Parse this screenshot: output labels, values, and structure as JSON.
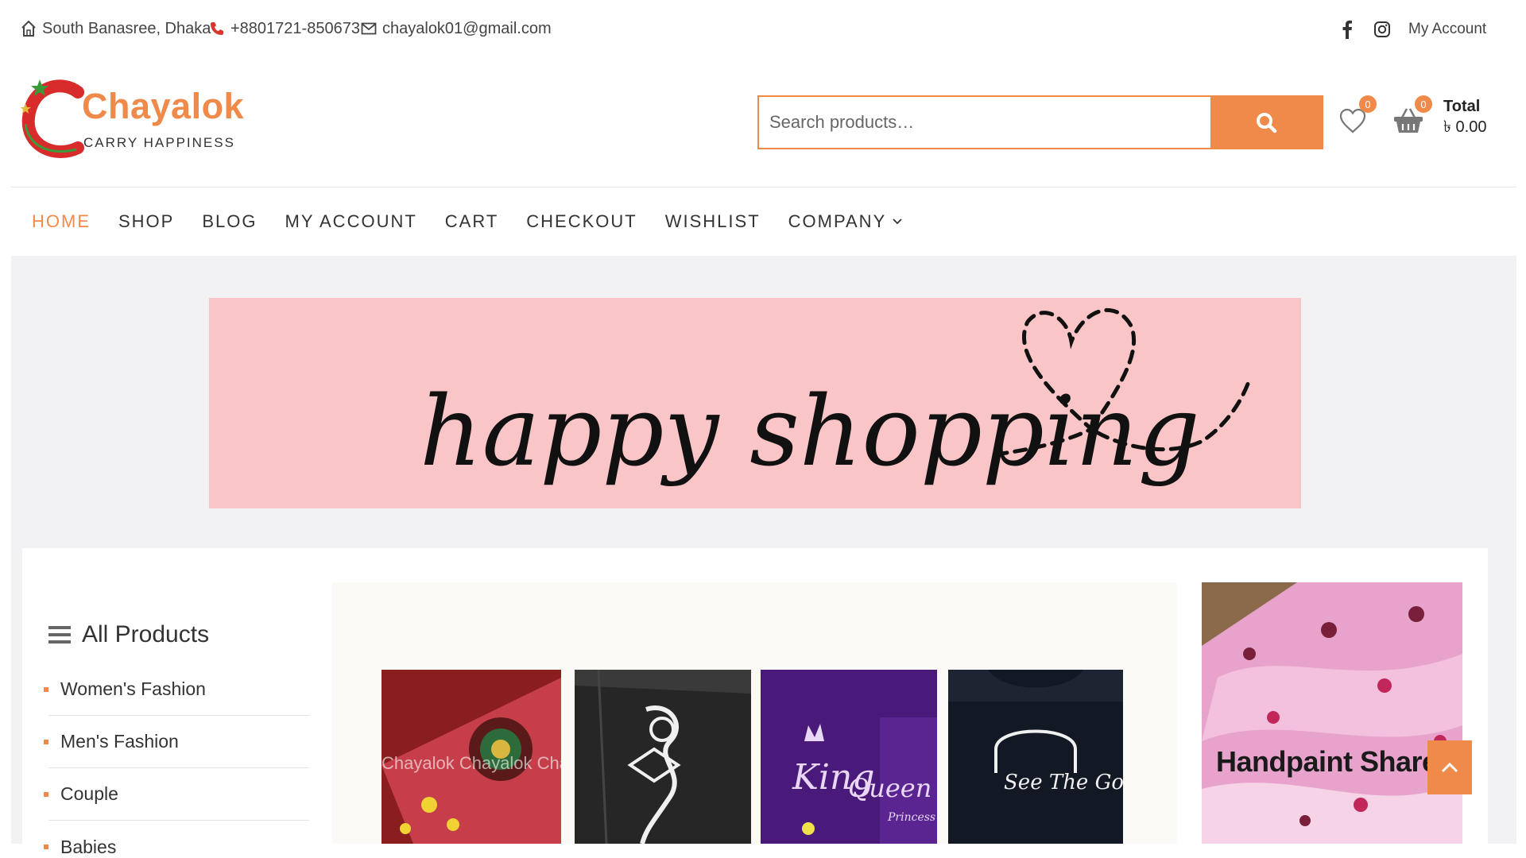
{
  "topbar": {
    "address": "South Banasree, Dhaka",
    "phone": "+8801721-850673",
    "email": "chayalok01@gmail.com",
    "account_link": "My Account"
  },
  "logo": {
    "name": "Chayalok",
    "tagline": "CARRY HAPPINESS"
  },
  "search": {
    "placeholder": "Search products…"
  },
  "header": {
    "wishlist_count": "0",
    "cart_count": "0",
    "total_label": "Total",
    "total_value": "৳ 0.00"
  },
  "nav": {
    "items": [
      {
        "label": "Home"
      },
      {
        "label": "Shop"
      },
      {
        "label": "Blog"
      },
      {
        "label": "My Account"
      },
      {
        "label": "Cart"
      },
      {
        "label": "Checkout"
      },
      {
        "label": "Wishlist"
      },
      {
        "label": "Company"
      }
    ]
  },
  "banner": {
    "text": "happy shopping"
  },
  "categories": {
    "title": "All Products",
    "items": [
      {
        "label": "Women's Fashion"
      },
      {
        "label": "Men's Fashion"
      },
      {
        "label": "Couple"
      },
      {
        "label": "Babies"
      }
    ]
  },
  "products": {
    "captions": [
      "Chayalok Chayalok Chayalok",
      "King",
      "Queen",
      "Princess",
      "See The Good Be The"
    ]
  },
  "promo": {
    "text": "Handpaint Shares"
  },
  "colors": {
    "accent": "#ef8a4a",
    "banner_bg": "#f9c5c6",
    "content_bg": "#f2f2f5"
  }
}
